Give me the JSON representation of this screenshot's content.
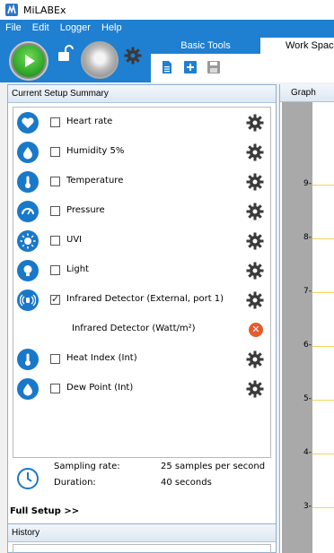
{
  "app": {
    "title": "MiLABEx"
  },
  "menu": [
    "File",
    "Edit",
    "Logger",
    "Help"
  ],
  "tabs": {
    "basic_tools": "Basic Tools",
    "work_space": "Work Space"
  },
  "setup": {
    "header": "Current Setup Summary",
    "sensors": [
      {
        "label": "Heart rate",
        "icon": "heart-icon",
        "checked": false
      },
      {
        "label": "Humidity 5%",
        "icon": "drop-icon",
        "checked": false
      },
      {
        "label": "Temperature",
        "icon": "thermometer-icon",
        "checked": false
      },
      {
        "label": "Pressure",
        "icon": "gauge-icon",
        "checked": false
      },
      {
        "label": "UVI",
        "icon": "sun-icon",
        "checked": false
      },
      {
        "label": "Light",
        "icon": "bulb-icon",
        "checked": false
      },
      {
        "label": "Infrared Detector (External, port 1)",
        "icon": "infrared-icon",
        "checked": true
      },
      {
        "label": "Infrared Detector (Watt/m²)",
        "icon": "",
        "checked": false,
        "sub": true
      },
      {
        "label": "Heat Index (Int)",
        "icon": "thermometer-icon",
        "checked": false
      },
      {
        "label": "Dew Point (Int)",
        "icon": "drop-icon",
        "checked": false
      }
    ],
    "sampling_rate_label": "Sampling rate:",
    "sampling_rate_value": "25 samples per second",
    "duration_label": "Duration:",
    "duration_value": "40 seconds",
    "full_setup": "Full Setup >>"
  },
  "history": {
    "header": "History"
  },
  "graph": {
    "tab": "Graph",
    "ticks": [
      "9",
      "8",
      "7",
      "6",
      "5",
      "4",
      "3"
    ]
  },
  "colors": {
    "accent": "#1f7fd0",
    "sensor_icon": "#1a78c9",
    "remove": "#e65a2e",
    "gridline": "#f4d35a"
  }
}
